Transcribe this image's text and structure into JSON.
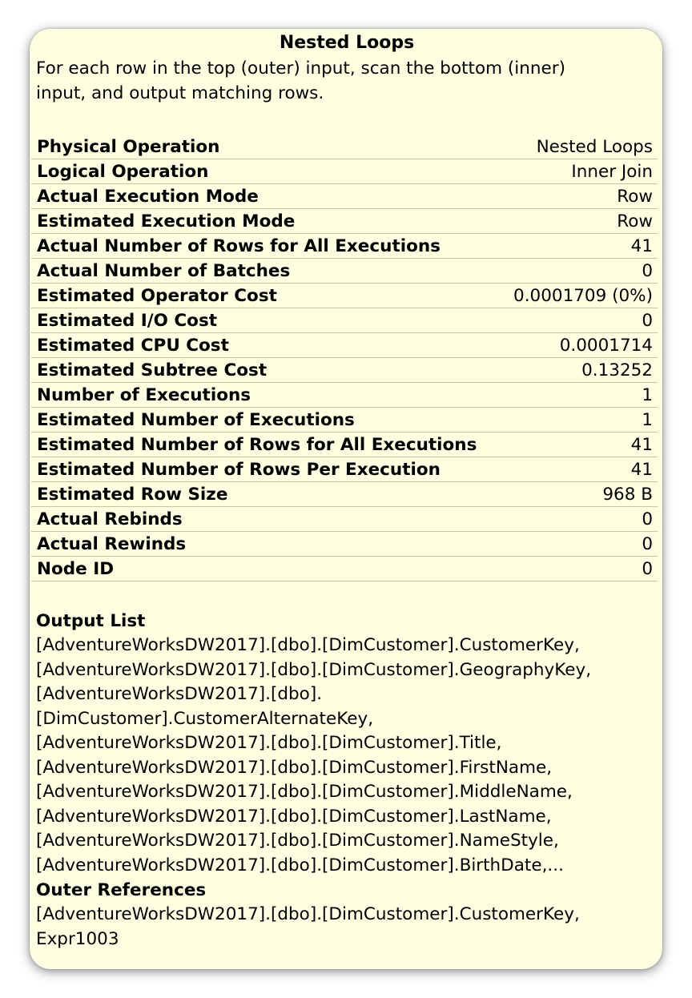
{
  "tooltip": {
    "title": "Nested Loops",
    "description": "For each row in the top (outer) input, scan the bottom (inner) input, and output matching rows.",
    "properties": [
      {
        "name": "Physical Operation",
        "value": "Nested Loops"
      },
      {
        "name": "Logical Operation",
        "value": "Inner Join"
      },
      {
        "name": "Actual Execution Mode",
        "value": "Row"
      },
      {
        "name": "Estimated Execution Mode",
        "value": "Row"
      },
      {
        "name": "Actual Number of Rows for All Executions",
        "value": "41"
      },
      {
        "name": "Actual Number of Batches",
        "value": "0"
      },
      {
        "name": "Estimated Operator Cost",
        "value": "0.0001709 (0%)"
      },
      {
        "name": "Estimated I/O Cost",
        "value": "0"
      },
      {
        "name": "Estimated CPU Cost",
        "value": "0.0001714"
      },
      {
        "name": "Estimated Subtree Cost",
        "value": "0.13252"
      },
      {
        "name": "Number of Executions",
        "value": "1"
      },
      {
        "name": "Estimated Number of Executions",
        "value": "1"
      },
      {
        "name": "Estimated Number of Rows for All Executions",
        "value": "41"
      },
      {
        "name": "Estimated Number of Rows Per Execution",
        "value": "41"
      },
      {
        "name": "Estimated Row Size",
        "value": "968 B"
      },
      {
        "name": "Actual Rebinds",
        "value": "0"
      },
      {
        "name": "Actual Rewinds",
        "value": "0"
      },
      {
        "name": "Node ID",
        "value": "0"
      }
    ],
    "output_list": {
      "heading": "Output List",
      "lines": [
        "[AdventureWorksDW2017].[dbo].[DimCustomer].CustomerKey,",
        "[AdventureWorksDW2017].[dbo].[DimCustomer].GeographyKey,",
        "[AdventureWorksDW2017].[dbo].",
        "[DimCustomer].CustomerAlternateKey,",
        "[AdventureWorksDW2017].[dbo].[DimCustomer].Title,",
        "[AdventureWorksDW2017].[dbo].[DimCustomer].FirstName,",
        "[AdventureWorksDW2017].[dbo].[DimCustomer].MiddleName,",
        "[AdventureWorksDW2017].[dbo].[DimCustomer].LastName,",
        "[AdventureWorksDW2017].[dbo].[DimCustomer].NameStyle,",
        "[AdventureWorksDW2017].[dbo].[DimCustomer].BirthDate,..."
      ]
    },
    "outer_references": {
      "heading": "Outer References",
      "lines": [
        "[AdventureWorksDW2017].[dbo].[DimCustomer].CustomerKey,",
        "Expr1003"
      ]
    }
  }
}
